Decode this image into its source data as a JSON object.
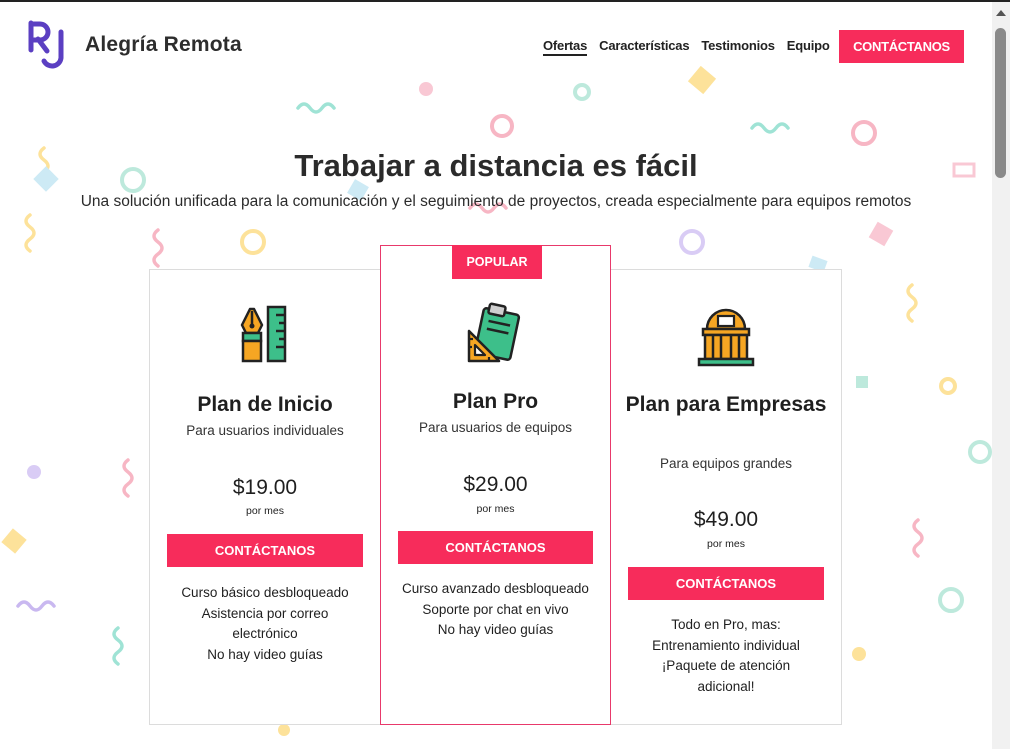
{
  "brand": {
    "monogram": "RJ",
    "name": "Alegría Remota",
    "accent": "#f72c5b",
    "logo_color": "#5b3fc2"
  },
  "nav": {
    "items": [
      {
        "label": "Ofertas",
        "active": true
      },
      {
        "label": "Características"
      },
      {
        "label": "Testimonios"
      },
      {
        "label": "Equipo"
      }
    ],
    "cta": "CONTÁCTANOS"
  },
  "hero": {
    "title": "Trabajar a distancia es fácil",
    "subtitle": "Una solución unificada para la comunicación y el seguimiento de proyectos, creada especialmente para equipos remotos"
  },
  "plans": [
    {
      "icon": "pen-ruler-icon",
      "name": "Plan de Inicio",
      "desc": "Para usuarios individuales",
      "price": "$19.00",
      "period": "por mes",
      "cta": "CONTÁCTANOS",
      "features": [
        "Curso básico desbloqueado",
        "Asistencia por correo electrónico",
        "No hay video guías"
      ]
    },
    {
      "badge": "POPULAR",
      "icon": "clipboard-icon",
      "name": "Plan Pro",
      "desc": "Para usuarios de equipos",
      "price": "$29.00",
      "period": "por mes",
      "cta": "CONTÁCTANOS",
      "features": [
        "Curso avanzado desbloqueado",
        "Soporte por chat en vivo",
        "No hay video guías"
      ]
    },
    {
      "icon": "building-icon",
      "name": "Plan para Empresas",
      "desc": "Para equipos grandes",
      "price": "$49.00",
      "period": "por mes",
      "cta": "CONTÁCTANOS",
      "features": [
        "Todo en Pro, mas:",
        "Entrenamiento individual",
        "¡Paquete de atención adicional!"
      ]
    }
  ]
}
